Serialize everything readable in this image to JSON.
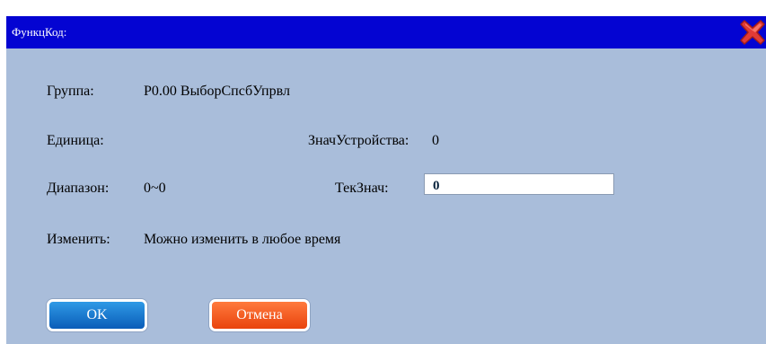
{
  "dialog": {
    "title": "ФункцКод:",
    "close_icon": "close-x-icon",
    "colors": {
      "title_bar": "#0404d2",
      "body": "#a9bdda",
      "ok_button": "#1272cf",
      "cancel_button": "#f35a1f",
      "close_icon": "#e23b36"
    }
  },
  "fields": {
    "group_label": "Группа:",
    "group_value": "P0.00 ВыборСпсбУпрвл",
    "unit_label": "Единица:",
    "device_value_label": "ЗначУстройства:",
    "device_value": "0",
    "range_label": "Диапазон:",
    "range_value": "0~0",
    "current_value_label": "ТекЗнач:",
    "current_value": "0",
    "modify_label": "Изменить:",
    "modify_value": "Можно изменить в любое время"
  },
  "buttons": {
    "ok_label": "OK",
    "cancel_label": "Отмена"
  }
}
